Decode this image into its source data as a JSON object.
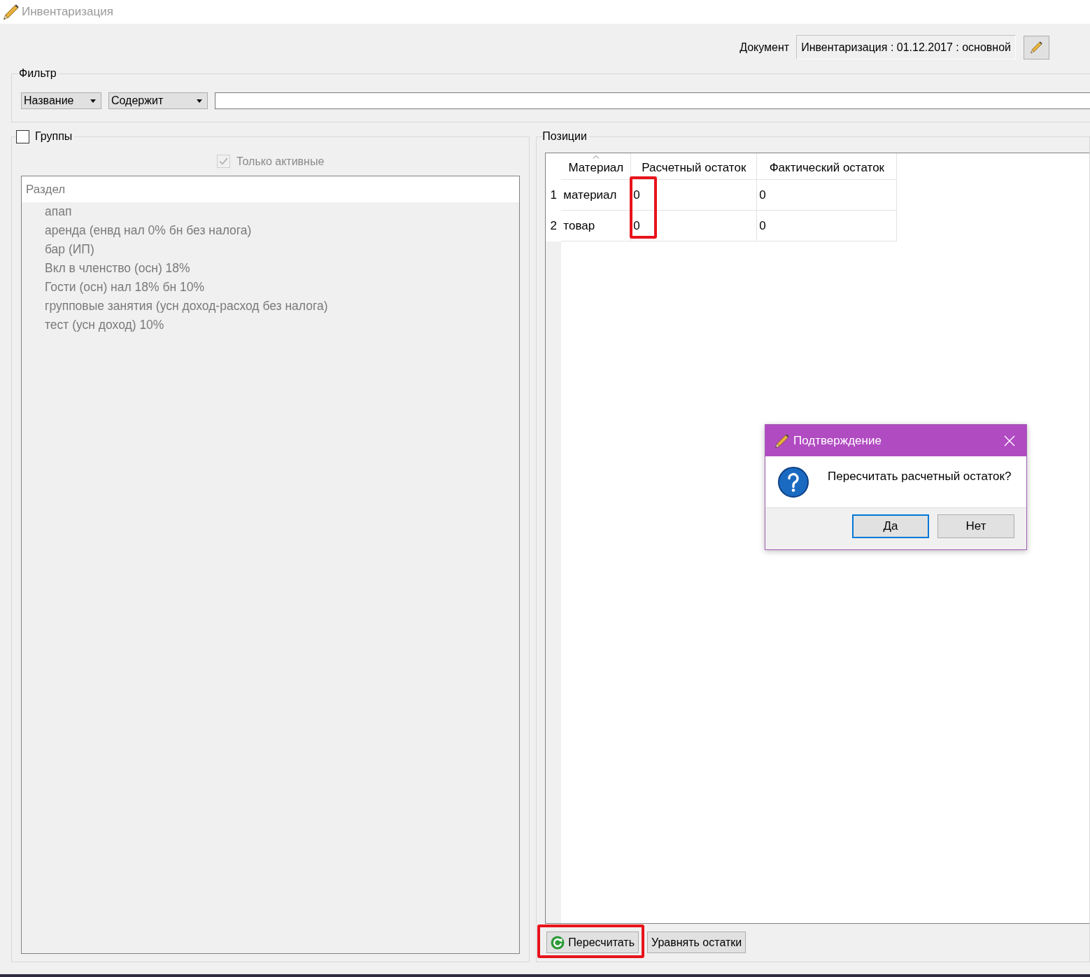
{
  "window": {
    "title": "Инвентаризация"
  },
  "document": {
    "label": "Документ",
    "value": "Инвентаризация : 01.12.2017 : основной"
  },
  "filter": {
    "title": "Фильтр",
    "field": "Название",
    "condition": "Содержит"
  },
  "groups": {
    "title": "Группы",
    "checked": false,
    "only_active": {
      "label": "Только активные",
      "checked": true,
      "disabled": true
    },
    "list": {
      "header": "Раздел",
      "disabled": true,
      "items": [
        {
          "label": "апап",
          "selected": false
        },
        {
          "label": "аренда (енвд нал 0% бн без налога)",
          "selected": false
        },
        {
          "label": "бар (ИП)",
          "selected": false
        },
        {
          "label": "Вкл в членство (осн) 18%",
          "selected": false
        },
        {
          "label": "Гости (осн) нал 18% бн 10%",
          "selected": false
        },
        {
          "label": "групповые занятия (усн доход-расход без налога)",
          "selected": false
        },
        {
          "label": "тест (усн доход) 10%",
          "selected": false
        }
      ]
    }
  },
  "positions": {
    "title": "Позиции",
    "table": {
      "columns": [
        {
          "label": "Материал",
          "sorted": true,
          "highlighted": false
        },
        {
          "label": "Расчетный остаток",
          "sorted": false,
          "highlighted": true
        },
        {
          "label": "Фактический остаток",
          "sorted": false,
          "highlighted": false
        }
      ],
      "rows": [
        {
          "number": "1",
          "cells": [
            "материал",
            "0",
            "0"
          ]
        },
        {
          "number": "2",
          "cells": [
            "товар",
            "0",
            "0"
          ]
        }
      ]
    },
    "buttons": [
      {
        "label": "Пересчитать",
        "icon": true,
        "highlighted": true
      },
      {
        "label": "Уравнять остатки",
        "icon": false,
        "highlighted": false
      }
    ]
  },
  "dialog": {
    "title": "Подтверждение",
    "message": "Пересчитать расчетный остаток?",
    "buttons": [
      {
        "label": "Да",
        "focused": true
      },
      {
        "label": "Нет",
        "focused": false
      }
    ]
  }
}
